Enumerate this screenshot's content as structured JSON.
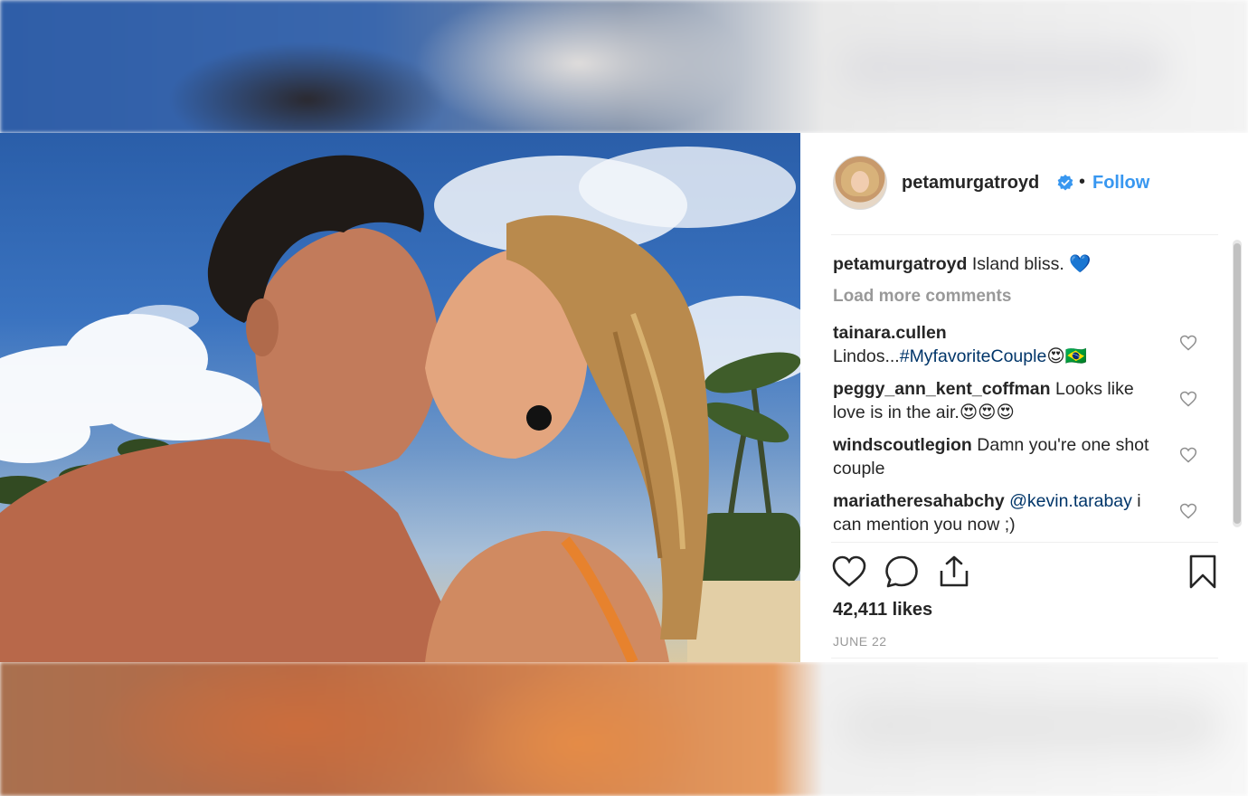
{
  "post": {
    "username": "petamurgatroyd",
    "separator": "•",
    "follow_label": "Follow",
    "caption_user": "petamurgatroyd",
    "caption_text": "Island bliss. 💙",
    "load_more": "Load more comments",
    "comments": [
      {
        "user": "tainara.cullen",
        "text_before": "Lindos...",
        "link": "#MyfavoriteCouple",
        "text_after": "😍🇧🇷"
      },
      {
        "user": "peggy_ann_kent_coffman",
        "text_before": "Looks like love is in the air.😍😍😍",
        "link": "",
        "text_after": ""
      },
      {
        "user": "windscoutlegion",
        "text_before": "Damn you're one shot couple",
        "link": "",
        "text_after": ""
      },
      {
        "user": "mariatheresahabchy",
        "text_before": "",
        "link": "@kevin.tarabay",
        "text_after": " i can mention you now ;)"
      }
    ],
    "likes": "42,411 likes",
    "date": "JUNE 22"
  },
  "icons": {
    "verified": "verified-badge-icon",
    "like": "heart-icon",
    "comment": "comment-bubble-icon",
    "share": "share-icon",
    "save": "bookmark-icon"
  },
  "colors": {
    "link": "#003569",
    "follow": "#3897f0",
    "verified": "#3897f0",
    "text": "#262626",
    "muted": "#999999"
  }
}
